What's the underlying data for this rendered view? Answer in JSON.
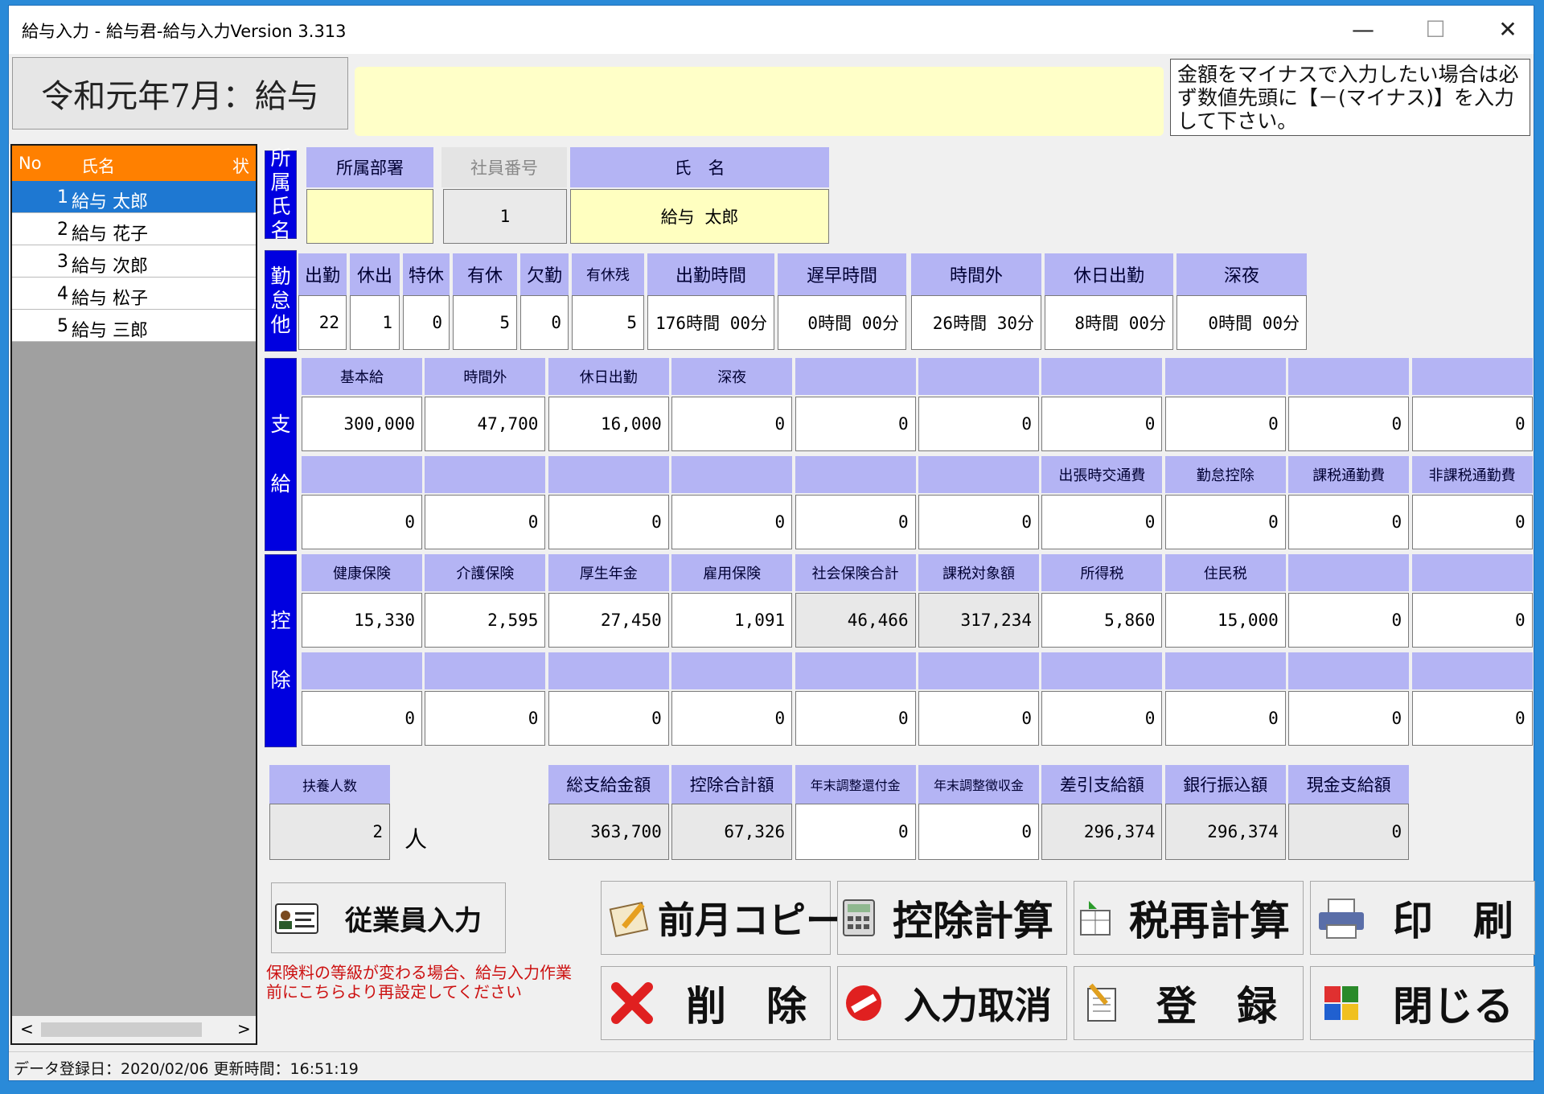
{
  "window": {
    "title": "給与入力 - 給与君-給与入力Version 3.313",
    "minimize": "—",
    "maximize": "☐",
    "close": "✕"
  },
  "period": "令和元年7月：給与",
  "notice": "金額をマイナスで入力したい場合は必ず数値先頭に【－(マイナス)】を入力して下さい。",
  "list": {
    "headers": [
      "No",
      "氏名",
      "状"
    ],
    "rows": [
      {
        "no": "1",
        "name": "給与 太郎"
      },
      {
        "no": "2",
        "name": "給与 花子"
      },
      {
        "no": "3",
        "name": "給与 次郎"
      },
      {
        "no": "4",
        "name": "給与 松子"
      },
      {
        "no": "5",
        "name": "給与 三郎"
      }
    ],
    "scroll_left": "<",
    "scroll_right": ">"
  },
  "sections": {
    "name": "所属氏名",
    "attendance": "勤怠他",
    "pay": "支給",
    "deduct": "控除"
  },
  "employee": {
    "dept_label": "所属部署",
    "id_label": "社員番号",
    "name_label": "氏　名",
    "dept": "",
    "id": "1",
    "name": "給与 太郎"
  },
  "attendance": {
    "labels": [
      "出勤",
      "休出",
      "特休",
      "有休",
      "欠勤",
      "有休残",
      "出勤時間",
      "遅早時間",
      "時間外",
      "休日出勤",
      "深夜"
    ],
    "values": [
      "22",
      "1",
      "0",
      "5",
      "0",
      "5",
      "176時間 00分",
      "0時間 00分",
      "26時間 30分",
      "8時間 00分",
      "0時間 00分"
    ]
  },
  "pay": {
    "labels1": [
      "基本給",
      "時間外",
      "休日出勤",
      "深夜",
      "",
      "",
      "",
      "",
      "",
      ""
    ],
    "values1": [
      "300,000",
      "47,700",
      "16,000",
      "0",
      "0",
      "0",
      "0",
      "0",
      "0",
      "0"
    ],
    "labels2": [
      "",
      "",
      "",
      "",
      "",
      "",
      "出張時交通費",
      "勤怠控除",
      "課税通勤費",
      "非課税通勤費"
    ],
    "values2": [
      "0",
      "0",
      "0",
      "0",
      "0",
      "0",
      "0",
      "0",
      "0",
      "0"
    ]
  },
  "deduct": {
    "labels1": [
      "健康保険",
      "介護保険",
      "厚生年金",
      "雇用保険",
      "社会保険合計",
      "課税対象額",
      "所得税",
      "住民税",
      "",
      ""
    ],
    "values1": [
      "15,330",
      "2,595",
      "27,450",
      "1,091",
      "46,466",
      "317,234",
      "5,860",
      "15,000",
      "0",
      "0"
    ],
    "labels2": [
      "",
      "",
      "",
      "",
      "",
      "",
      "",
      "",
      "",
      ""
    ],
    "values2": [
      "0",
      "0",
      "0",
      "0",
      "0",
      "0",
      "0",
      "0",
      "0",
      "0"
    ]
  },
  "dependents": {
    "label": "扶養人数",
    "value": "2",
    "unit": "人"
  },
  "summary": {
    "labels": [
      "総支給金額",
      "控除合計額",
      "年末調整還付金",
      "年末調整徴収金",
      "差引支給額",
      "銀行振込額",
      "現金支給額"
    ],
    "values": [
      "363,700",
      "67,326",
      "0",
      "0",
      "296,374",
      "296,374",
      "0"
    ]
  },
  "buttons": {
    "employee": "従業員入力",
    "copy": "前月コピー",
    "calc": "控除計算",
    "tax": "税再計算",
    "print": "印　刷",
    "delete": "削　除",
    "cancel": "入力取消",
    "register": "登　録",
    "close": "閉じる"
  },
  "warning": "保険料の等級が変わる場合、給与入力作業前にこちらより再設定してください",
  "status": "データ登録日：2020/02/06 更新時間：16:51:19",
  "colors": {
    "section": "#0000e0",
    "header": "#b4b4f4",
    "list_header": "#ff8000",
    "selected": "#1e78d2",
    "input_yellow": "#ffffc0"
  }
}
